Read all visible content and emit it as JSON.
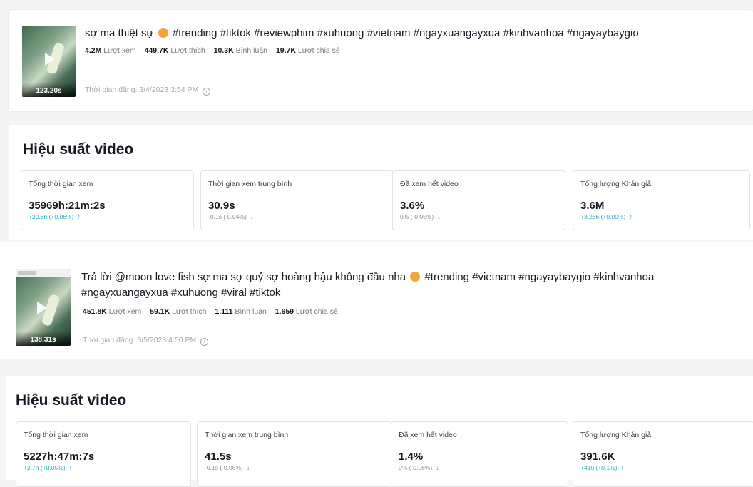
{
  "videos": [
    {
      "title_before_emoji": "sợ ma thiệt sự",
      "title_after_emoji": "#trending #tiktok #reviewphim #xuhuong #vietnam #ngayxuangayxua #kinhvanhoa #ngayaybaygio",
      "title_line2": "",
      "duration": "123.20s",
      "stats": {
        "views_value": "4.2M",
        "views_label": "Lượt xem",
        "likes_value": "449.7K",
        "likes_label": "Lượt thích",
        "comments_value": "10.3K",
        "comments_label": "Bình luận",
        "shares_value": "19.7K",
        "shares_label": "Lượt chia sẻ"
      },
      "posted": "Thời gian đăng: 3/4/2023 3:54 PM",
      "performance_title": "Hiệu suất video",
      "metrics": [
        {
          "label": "Tổng thời gian xem",
          "value": "35969h:21m:2s",
          "delta": "+20.6h (+0.06%)",
          "trend": "up",
          "arrow": "↑"
        },
        {
          "label": "Thời gian xem trung bình",
          "value": "30.9s",
          "delta": "-0.1s (-0.04%)",
          "trend": "down",
          "arrow": "↓"
        },
        {
          "label": "Đã xem hết video",
          "value": "3.6%",
          "delta": "0% (-0.05%)",
          "trend": "down",
          "arrow": "↓"
        },
        {
          "label": "Tổng lượng Khán giả",
          "value": "3.6M",
          "delta": "+3,286 (+0.09%)",
          "trend": "up",
          "arrow": "↑"
        }
      ]
    },
    {
      "title_before_emoji": "Trả lời @moon love fish sợ ma sợ quỷ sợ hoàng hậu không đầu nha",
      "title_after_emoji": "#trending #vietnam #ngayaybaygio #kinhvanhoa",
      "title_line2": "#ngayxuangayxua #xuhuong #viral #tiktok",
      "duration": "138.31s",
      "stats": {
        "views_value": "451.8K",
        "views_label": "Lượt xem",
        "likes_value": "59.1K",
        "likes_label": "Lượt thích",
        "comments_value": "1,111",
        "comments_label": "Bình luận",
        "shares_value": "1,659",
        "shares_label": "Lượt chia sẻ"
      },
      "posted": "Thời gian đăng: 3/5/2023 4:50 PM",
      "performance_title": "Hiệu suất video",
      "metrics": [
        {
          "label": "Tổng thời gian xem",
          "value": "5227h:47m:7s",
          "delta": "+2.7h (+0.05%)",
          "trend": "up",
          "arrow": "↑"
        },
        {
          "label": "Thời gian xem trung bình",
          "value": "41.5s",
          "delta": "-0.1s (-0.06%)",
          "trend": "down",
          "arrow": "↓"
        },
        {
          "label": "Đã xem hết video",
          "value": "1.4%",
          "delta": "0% (-0.06%)",
          "trend": "down",
          "arrow": "↓"
        },
        {
          "label": "Tổng lượng Khán giả",
          "value": "391.6K",
          "delta": "+410 (+0.1%)",
          "trend": "up",
          "arrow": "↑"
        }
      ]
    }
  ],
  "icons": {
    "info": "info-icon",
    "play": "play-icon",
    "emoji": "emoji-icon"
  },
  "colors": {
    "up": "#20b0c4",
    "down": "#8a8b91",
    "text": "#161823"
  }
}
